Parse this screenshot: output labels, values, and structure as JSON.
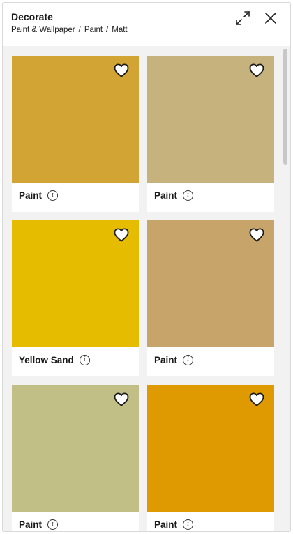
{
  "header": {
    "title": "Decorate",
    "breadcrumb": [
      "Paint & Wallpaper",
      "Paint",
      "Matt"
    ],
    "separator": "/"
  },
  "icons": {
    "expand": "expand-icon",
    "close": "close-icon",
    "favourite": "heart-outline-icon",
    "info": "info-icon"
  },
  "info_glyph": "i",
  "products": [
    {
      "label": "Paint",
      "color": "#d1a434"
    },
    {
      "label": "Paint",
      "color": "#c6b27c"
    },
    {
      "label": "Yellow Sand",
      "color": "#e5bc00"
    },
    {
      "label": "Paint",
      "color": "#c6a46a"
    },
    {
      "label": "Paint",
      "color": "#c1bf86"
    },
    {
      "label": "Paint",
      "color": "#de9a00"
    }
  ]
}
